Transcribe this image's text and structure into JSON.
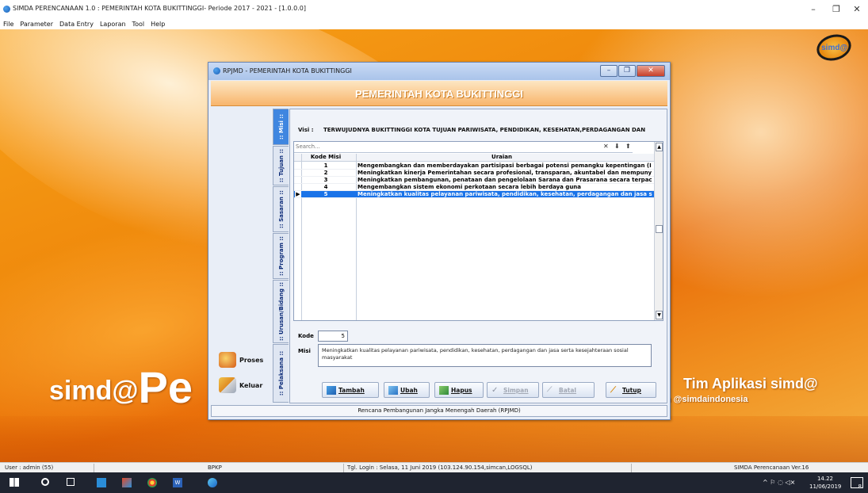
{
  "window": {
    "title": "SIMDA PERENCANAAN 1.0 : PEMERINTAH KOTA BUKITTINGGI- Periode 2017 - 2021 - [1.0.0.0]",
    "controls": {
      "minimize": "–",
      "maximize": "❐",
      "close": "✕"
    }
  },
  "menu": [
    "File",
    "Parameter",
    "Data Entry",
    "Laporan",
    "Tool",
    "Help"
  ],
  "background": {
    "brand_left_a": "simd@",
    "brand_left_b": "Pe",
    "brand_right": "Tim Aplikasi simd@",
    "brand_url": "www.simda-online.com timaplikasi@yahoo.com @simdaindonesia",
    "logo_text": "simd@"
  },
  "dialog": {
    "title": "RPJMD - PEMERINTAH KOTA BUKITTINGGI",
    "header": "PEMERINTAH KOTA BUKITTINGGI",
    "side_buttons": [
      {
        "label": "Proses"
      },
      {
        "label": "Keluar"
      }
    ],
    "tabs": [
      ":: Misi ::",
      ":: Tujuan ::",
      ":: Sasaran ::",
      ":: Program ::",
      ":: Urusan/Bidang ::",
      ":: Pelaksana ::"
    ],
    "visi_label": "Visi :",
    "visi_text": "TERWUJUDNYA BUKITTINGGI KOTA TUJUAN PARIWISATA, PENDIDIKAN, KESEHATAN,PERDAGANGAN DAN",
    "search_placeholder": "Search...",
    "search_tools": {
      "clear": "✕",
      "down": "⬇",
      "up": "⬆"
    },
    "columns": [
      "Kode Misi",
      "Uraian"
    ],
    "rows": [
      {
        "kode": "1",
        "uraian": "Mengembangkan dan memberdayakan partisipasi berbagai potensi pemangku kepentingan (I"
      },
      {
        "kode": "2",
        "uraian": "Meningkatkan kinerja Pemerintahan secara profesional, transparan, akuntabel dan mempuny"
      },
      {
        "kode": "3",
        "uraian": "Meningkatkan pembangunan, penataan dan pengelolaan Sarana dan Prasarana  secara terpac"
      },
      {
        "kode": "4",
        "uraian": "Mengembangkan sistem ekonomi perkotaan secara lebih berdaya guna"
      },
      {
        "kode": "5",
        "uraian": "Meningkatkan kualitas pelayanan pariwisata, pendidikan, kesehatan, perdagangan dan jasa s"
      }
    ],
    "selected_indicator": "▶",
    "kode_label": "Kode",
    "kode_value": "5",
    "misi_label": "Misi",
    "misi_value": "Meningkatkan kualitas pelayanan pariwisata, pendidikan, kesehatan, perdagangan dan jasa serta kesejahteraan sosial masyarakat",
    "actions": {
      "tambah": "Tambah",
      "ubah": "Ubah",
      "hapus": "Hapus",
      "simpan": "Simpan",
      "batal": "Batal",
      "tutup": "Tutup"
    },
    "status": "Rencana Pembangunan Jangka Menengah Daerah (RPJMD)"
  },
  "statusbar": {
    "user": "User : admin (55)",
    "org": "BPKP",
    "login": "Tgl. Login : Selasa,  11 Juni 2019 (103.124.90.154,simcan,LOGSQL)",
    "version": "SIMDA Perencanaan Ver.16"
  },
  "taskbar": {
    "time": "14.22",
    "date": "11/06/2019",
    "tray": "^ ⚐ ◌ ◁× ",
    "notif": "8"
  },
  "colors": {
    "selected_row": "#1a73e8",
    "tab_active": "#3f86e0",
    "header_gradient_end": "#f8b56c"
  }
}
